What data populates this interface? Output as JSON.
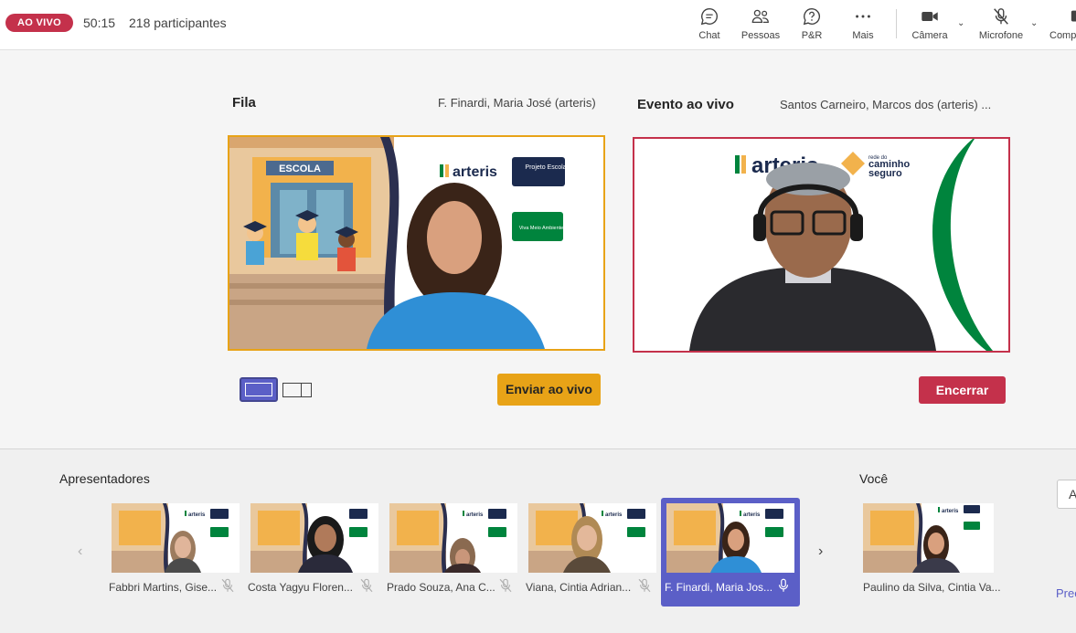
{
  "header": {
    "live_badge": "AO VIVO",
    "timer": "50:15",
    "participants": "218 participantes",
    "tools": {
      "chat": "Chat",
      "people": "Pessoas",
      "qa": "P&R",
      "more": "Mais",
      "camera": "Câmera",
      "microphone": "Microfone",
      "share": "Comp"
    }
  },
  "queue": {
    "title": "Fila",
    "presenter": "F. Finardi, Maria José (arteris)",
    "send_button": "Enviar ao vivo"
  },
  "live": {
    "title": "Evento ao vivo",
    "presenter": "Santos Carneiro, Marcos dos (arteris) ...",
    "end_button": "Encerrar"
  },
  "backdrop": {
    "school_sign": "ESCOLA",
    "brand": "arteris",
    "badge1": "Projeto Escola",
    "badge2": "Viva Meio Ambiente",
    "caminho_small": "rede do",
    "caminho_big": "caminho",
    "caminho_big2": "seguro"
  },
  "presenters": {
    "title": "Apresentadores",
    "items": [
      {
        "name": "Fabbri Martins, Gise..."
      },
      {
        "name": "Costa Yagyu Floren..."
      },
      {
        "name": "Prado Souza, Ana C..."
      },
      {
        "name": "Viana, Cintia Adrian..."
      },
      {
        "name": "F. Finardi, Maria Jos..."
      }
    ]
  },
  "you": {
    "title": "Você",
    "name": "Paulino da Silva, Cintia Va..."
  },
  "side": {
    "input_letter": "A",
    "link_text": "Prec"
  },
  "colors": {
    "live_red": "#c4314b",
    "queue_amber": "#e8a317",
    "accent_purple": "#5b5fc7",
    "arteris_green": "#00843d",
    "arteris_navy": "#1b2a4e"
  }
}
